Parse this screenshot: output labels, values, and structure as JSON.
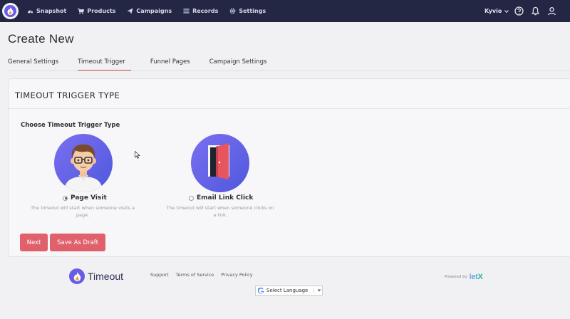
{
  "topbar": {
    "nav": [
      {
        "label": "Snapshot",
        "icon": "dashboard-icon"
      },
      {
        "label": "Products",
        "icon": "cart-icon"
      },
      {
        "label": "Campaigns",
        "icon": "paper-plane-icon"
      },
      {
        "label": "Records",
        "icon": "list-icon"
      },
      {
        "label": "Settings",
        "icon": "gear-icon"
      }
    ],
    "user": "Kyvio"
  },
  "page": {
    "title": "Create New",
    "tabs": [
      "General Settings",
      "Timeout Trigger",
      "Funnel Pages",
      "Campaign Settings"
    ],
    "active_tab": "Timeout Trigger"
  },
  "panel": {
    "heading": "TIMEOUT TRIGGER TYPE",
    "choose_label": "Choose Timeout Trigger Type",
    "options": [
      {
        "label": "Page Visit",
        "selected": true,
        "desc_line1": "The timeout will start when someone visits a",
        "desc_line2": "page."
      },
      {
        "label": "Email Link Click",
        "selected": false,
        "desc_line1": "The timeout will start when someone clicks on",
        "desc_line2": "a link."
      }
    ],
    "buttons": {
      "next": "Next",
      "draft": "Save As Draft"
    }
  },
  "footer": {
    "logo_text": "Timeout",
    "links": [
      "Support",
      "Terms of Service",
      "Privacy Policy"
    ],
    "language": "Select Language",
    "powered_by": "Powered by",
    "brand": "let",
    "brand_x": "X"
  },
  "colors": {
    "topbar": "#232744",
    "accent": "#e0606b",
    "brand_purple": "#6a5ce6"
  }
}
